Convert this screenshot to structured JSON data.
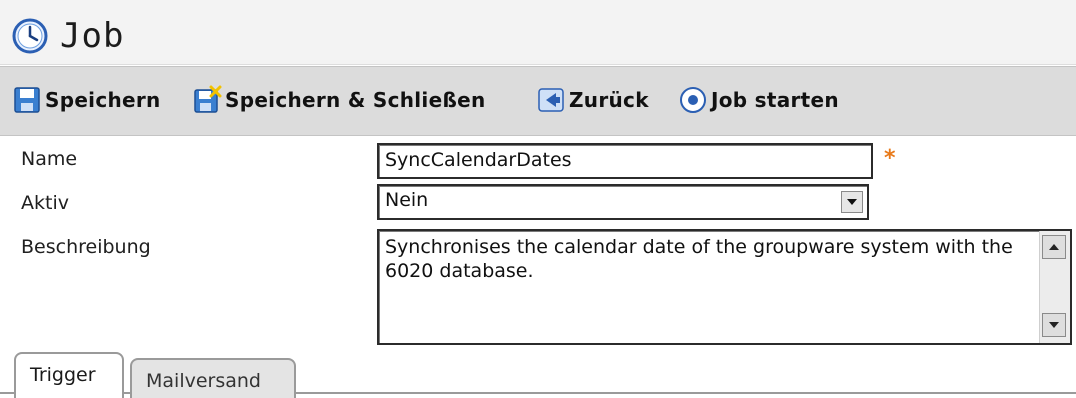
{
  "header": {
    "title": "Job",
    "icon": "clock-icon"
  },
  "toolbar": {
    "save_label": "Speichern",
    "save_close_label": "Speichern & Schließen",
    "back_label": "Zurück",
    "start_job_label": "Job starten"
  },
  "form": {
    "name": {
      "label": "Name",
      "value": "SyncCalendarDates",
      "required_marker": "*"
    },
    "aktiv": {
      "label": "Aktiv",
      "value": "Nein"
    },
    "beschreibung": {
      "label": "Beschreibung",
      "value": "Synchronises the calendar date of the groupware system with the 6020 database."
    }
  },
  "tabs": [
    {
      "label": "Trigger",
      "active": true
    },
    {
      "label": "Mailversand",
      "active": false
    }
  ],
  "colors": {
    "toolbar_bg": "#dcdcdc",
    "title_bg": "#f3f3f3",
    "icon_blue": "#3a7fd0",
    "required": "#e87a1a"
  }
}
